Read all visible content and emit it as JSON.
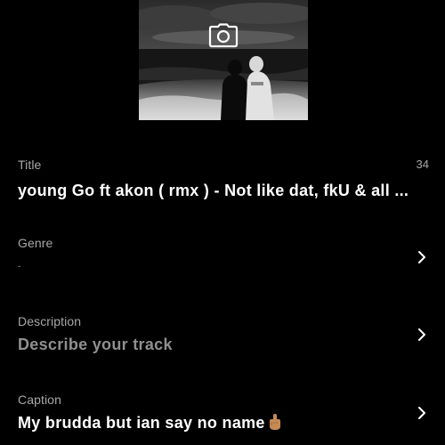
{
  "artwork": {
    "camera_icon": "camera-icon"
  },
  "fields": {
    "title": {
      "label": "Title",
      "value": "young Go ft akon ( rmx ) - Not like dat, fkU & all ...",
      "char_count": "34"
    },
    "genre": {
      "label": "Genre",
      "value": "-",
      "icon": "chevron-right-icon"
    },
    "description": {
      "label": "Description",
      "placeholder": "Describe your track",
      "icon": "chevron-right-icon"
    },
    "caption": {
      "label": "Caption",
      "value": "My brudda but ian say no name",
      "emoji": "middle-finger-emoji",
      "icon": "chevron-right-icon"
    }
  }
}
